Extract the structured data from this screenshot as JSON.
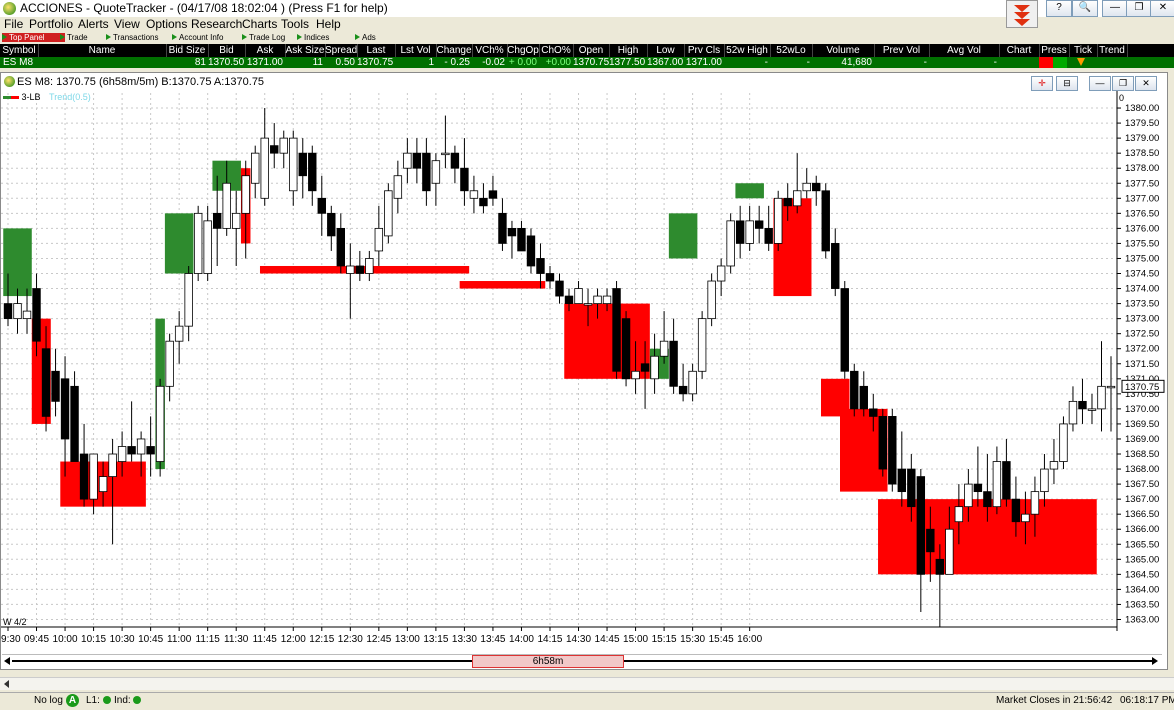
{
  "window": {
    "title": "ACCIONES - QuoteTracker - (04/17/08 18:02:04 ) (Press F1 for help)",
    "controls": [
      "?",
      "🔍",
      "—",
      "❐",
      "✕"
    ]
  },
  "menu": [
    "File",
    "Portfolio",
    "Alerts",
    "View",
    "Options",
    "Research",
    "Charts",
    "Tools",
    "Help"
  ],
  "tabs": [
    "Top Panel",
    "Trade",
    "Transactions",
    "Account Info",
    "Trade Log",
    "Indices",
    "Ads"
  ],
  "quote_table": {
    "columns": [
      "Symbol",
      "Name",
      "Bid Size",
      "Bid",
      "Ask",
      "Ask Size",
      "Spread",
      "Last",
      "Lst Vol",
      "Change",
      "VCh%",
      "ChgOp",
      "ChO%",
      "Open",
      "High",
      "Low",
      "Prv Cls",
      "52w High",
      "52wLo",
      "Volume",
      "Prev Vol",
      "Avg Vol",
      "Chart",
      "Press",
      "Tick",
      "Trend"
    ],
    "row": [
      "ES M8",
      "",
      "81",
      "1370.50",
      "1371.00",
      "11",
      "0.50",
      "1370.75",
      "1",
      "- 0.25",
      "-0.02",
      "+ 0.00",
      "+0.00",
      "1370.75",
      "1377.50",
      "1367.00",
      "1371.00",
      "-",
      "-",
      "41,680",
      "-",
      "-",
      "",
      "",
      "",
      ""
    ]
  },
  "chart_window": {
    "title": "ES M8: 1370.75 (6h58m/5m)  B:1370.75  A:1370.75",
    "legend_main": "3-LB",
    "legend_study": "Trend(0.5)",
    "day_marker": "W 4/2",
    "scroll_label": "6h58m",
    "current_price_label": "1370.75",
    "yaxis_top_marker": "0"
  },
  "chart_data": {
    "type": "candlestick",
    "symbol": "ES M8",
    "interval": "5m",
    "ylim": [
      1362.75,
      1380.5
    ],
    "y_ticks": [
      "1380.00",
      "1379.50",
      "1379.00",
      "1378.50",
      "1378.00",
      "1377.50",
      "1377.00",
      "1376.50",
      "1376.00",
      "1375.50",
      "1375.00",
      "1374.50",
      "1374.00",
      "1373.50",
      "1373.00",
      "1372.50",
      "1372.00",
      "1371.50",
      "1371.00",
      "1370.50",
      "1370.00",
      "1369.50",
      "1369.00",
      "1368.50",
      "1368.00",
      "1367.50",
      "1367.00",
      "1366.50",
      "1366.00",
      "1365.50",
      "1365.00",
      "1364.50",
      "1364.00",
      "1363.50",
      "1363.00"
    ],
    "x_ticks": [
      "09:30",
      "09:45",
      "10:00",
      "10:15",
      "10:30",
      "10:45",
      "11:00",
      "11:15",
      "11:30",
      "11:45",
      "12:00",
      "12:15",
      "12:30",
      "12:45",
      "13:00",
      "13:15",
      "13:30",
      "13:45",
      "14:00",
      "14:15",
      "14:30",
      "14:45",
      "15:00",
      "15:15",
      "15:30",
      "15:45",
      "16:00"
    ],
    "candles": [
      [
        1373.5,
        1374.5,
        1372.75,
        1373.0
      ],
      [
        1373.0,
        1374.0,
        1372.5,
        1373.5
      ],
      [
        1373.0,
        1374.0,
        1372.5,
        1373.25
      ],
      [
        1374.0,
        1374.5,
        1371.75,
        1372.25
      ],
      [
        1372.0,
        1372.75,
        1369.25,
        1369.75
      ],
      [
        1371.25,
        1372.0,
        1369.75,
        1370.25
      ],
      [
        1371.0,
        1371.75,
        1367.75,
        1369.0
      ],
      [
        1370.75,
        1371.25,
        1368.5,
        1368.25
      ],
      [
        1368.5,
        1369.5,
        1366.75,
        1367.0
      ],
      [
        1367.0,
        1368.5,
        1366.5,
        1368.5
      ],
      [
        1367.25,
        1368.25,
        1366.75,
        1367.75
      ],
      [
        1367.75,
        1369.0,
        1365.5,
        1368.5
      ],
      [
        1368.25,
        1369.25,
        1367.75,
        1368.75
      ],
      [
        1368.75,
        1370.25,
        1368.25,
        1368.5
      ],
      [
        1368.5,
        1369.25,
        1367.75,
        1369.0
      ],
      [
        1368.75,
        1369.75,
        1367.75,
        1368.5
      ],
      [
        1368.25,
        1371.0,
        1367.75,
        1370.75
      ],
      [
        1370.75,
        1372.5,
        1370.25,
        1372.25
      ],
      [
        1372.25,
        1373.25,
        1371.5,
        1372.75
      ],
      [
        1372.75,
        1374.75,
        1372.25,
        1374.5
      ],
      [
        1374.5,
        1376.75,
        1374.25,
        1376.5
      ],
      [
        1374.5,
        1376.75,
        1374.25,
        1376.25
      ],
      [
        1376.5,
        1377.75,
        1374.75,
        1376.0
      ],
      [
        1376.0,
        1378.25,
        1375.75,
        1377.5
      ],
      [
        1376.0,
        1377.25,
        1374.75,
        1376.5
      ],
      [
        1376.5,
        1378.25,
        1375.0,
        1377.75
      ],
      [
        1377.5,
        1378.75,
        1377.0,
        1378.5
      ],
      [
        1377.0,
        1380.0,
        1376.75,
        1379.0
      ],
      [
        1378.75,
        1379.5,
        1378.0,
        1378.5
      ],
      [
        1378.5,
        1379.25,
        1378.0,
        1379.0
      ],
      [
        1377.25,
        1379.25,
        1376.75,
        1379.0
      ],
      [
        1378.5,
        1379.0,
        1377.0,
        1377.75
      ],
      [
        1378.5,
        1378.75,
        1376.75,
        1377.25
      ],
      [
        1377.0,
        1377.75,
        1375.75,
        1376.5
      ],
      [
        1376.5,
        1376.75,
        1375.25,
        1375.75
      ],
      [
        1376.0,
        1376.5,
        1374.5,
        1374.75
      ],
      [
        1374.5,
        1375.5,
        1373.0,
        1374.75
      ],
      [
        1374.75,
        1375.25,
        1374.25,
        1374.5
      ],
      [
        1374.5,
        1375.25,
        1374.25,
        1375.0
      ],
      [
        1375.25,
        1376.75,
        1374.75,
        1376.0
      ],
      [
        1375.75,
        1377.5,
        1375.5,
        1377.25
      ],
      [
        1377.0,
        1378.25,
        1376.5,
        1377.75
      ],
      [
        1378.0,
        1379.0,
        1377.5,
        1378.5
      ],
      [
        1378.5,
        1379.0,
        1377.5,
        1378.0
      ],
      [
        1378.5,
        1379.0,
        1376.75,
        1377.25
      ],
      [
        1377.5,
        1378.5,
        1376.75,
        1378.25
      ],
      [
        1378.5,
        1379.75,
        1378.0,
        1378.5
      ],
      [
        1378.5,
        1378.75,
        1377.5,
        1378.0
      ],
      [
        1378.0,
        1379.0,
        1376.75,
        1377.25
      ],
      [
        1377.0,
        1377.75,
        1376.5,
        1377.25
      ],
      [
        1377.0,
        1377.5,
        1376.5,
        1376.75
      ],
      [
        1377.25,
        1377.75,
        1376.75,
        1377.0
      ],
      [
        1376.5,
        1377.0,
        1375.25,
        1375.5
      ],
      [
        1376.0,
        1376.25,
        1375.0,
        1375.75
      ],
      [
        1376.0,
        1376.25,
        1375.25,
        1375.25
      ],
      [
        1375.75,
        1376.0,
        1374.5,
        1374.75
      ],
      [
        1375.0,
        1375.5,
        1374.0,
        1374.5
      ],
      [
        1374.5,
        1374.75,
        1374.0,
        1374.25
      ],
      [
        1374.25,
        1374.5,
        1373.5,
        1373.75
      ],
      [
        1373.75,
        1374.0,
        1373.25,
        1373.5
      ],
      [
        1373.5,
        1374.25,
        1373.5,
        1374.0
      ],
      [
        1373.5,
        1374.0,
        1372.75,
        1373.5
      ],
      [
        1373.5,
        1374.0,
        1373.0,
        1373.75
      ],
      [
        1373.5,
        1374.0,
        1373.25,
        1373.75
      ],
      [
        1374.0,
        1374.25,
        1371.0,
        1371.25
      ],
      [
        1373.0,
        1373.25,
        1370.75,
        1371.0
      ],
      [
        1371.0,
        1372.25,
        1370.5,
        1371.25
      ],
      [
        1371.5,
        1372.25,
        1370.0,
        1371.25
      ],
      [
        1371.0,
        1372.5,
        1370.5,
        1371.75
      ],
      [
        1371.75,
        1373.25,
        1371.5,
        1372.25
      ],
      [
        1372.25,
        1373.0,
        1370.5,
        1370.75
      ],
      [
        1370.75,
        1371.5,
        1370.25,
        1370.5
      ],
      [
        1370.5,
        1371.5,
        1370.25,
        1371.25
      ],
      [
        1371.25,
        1373.25,
        1371.0,
        1373.0
      ],
      [
        1373.0,
        1374.5,
        1372.75,
        1374.25
      ],
      [
        1374.25,
        1375.0,
        1373.75,
        1374.75
      ],
      [
        1374.75,
        1376.5,
        1374.5,
        1376.25
      ],
      [
        1376.25,
        1376.75,
        1375.0,
        1375.5
      ],
      [
        1375.5,
        1376.75,
        1375.25,
        1376.25
      ],
      [
        1376.25,
        1376.75,
        1375.5,
        1376.0
      ],
      [
        1376.0,
        1376.75,
        1375.25,
        1375.5
      ],
      [
        1375.5,
        1377.25,
        1375.25,
        1377.0
      ],
      [
        1377.0,
        1377.5,
        1376.25,
        1376.75
      ],
      [
        1376.75,
        1378.5,
        1376.5,
        1377.25
      ],
      [
        1377.25,
        1378.0,
        1377.0,
        1377.5
      ],
      [
        1377.5,
        1377.75,
        1376.75,
        1377.25
      ],
      [
        1377.25,
        1377.5,
        1375.0,
        1375.25
      ],
      [
        1375.5,
        1376.0,
        1373.75,
        1374.0
      ],
      [
        1374.0,
        1374.25,
        1371.0,
        1371.25
      ],
      [
        1371.25,
        1371.5,
        1369.75,
        1370.0
      ],
      [
        1370.75,
        1371.25,
        1369.75,
        1370.0
      ],
      [
        1370.0,
        1370.5,
        1369.25,
        1369.75
      ],
      [
        1369.75,
        1370.0,
        1367.75,
        1368.0
      ],
      [
        1369.75,
        1370.0,
        1367.25,
        1367.5
      ],
      [
        1368.0,
        1369.25,
        1366.75,
        1367.25
      ],
      [
        1368.0,
        1368.5,
        1366.25,
        1366.75
      ],
      [
        1367.75,
        1368.0,
        1363.25,
        1364.5
      ],
      [
        1366.0,
        1366.75,
        1364.25,
        1365.25
      ],
      [
        1365.0,
        1365.5,
        1362.75,
        1364.5
      ],
      [
        1364.5,
        1366.75,
        1364.5,
        1366.0
      ],
      [
        1366.25,
        1367.5,
        1365.5,
        1366.75
      ],
      [
        1366.75,
        1368.0,
        1366.25,
        1367.5
      ],
      [
        1367.5,
        1368.75,
        1366.75,
        1367.25
      ],
      [
        1367.25,
        1368.5,
        1366.25,
        1366.75
      ],
      [
        1366.75,
        1368.75,
        1366.5,
        1368.25
      ],
      [
        1368.25,
        1369.0,
        1366.75,
        1367.0
      ],
      [
        1367.0,
        1367.75,
        1365.75,
        1366.25
      ],
      [
        1366.25,
        1367.25,
        1365.5,
        1366.5
      ],
      [
        1366.5,
        1367.75,
        1365.75,
        1367.25
      ],
      [
        1367.25,
        1368.5,
        1366.75,
        1368.0
      ],
      [
        1368.0,
        1369.0,
        1367.5,
        1368.25
      ],
      [
        1368.25,
        1369.75,
        1368.0,
        1369.5
      ],
      [
        1369.5,
        1370.75,
        1369.25,
        1370.25
      ],
      [
        1370.25,
        1371.0,
        1369.5,
        1370.0
      ],
      [
        1370.0,
        1370.5,
        1369.5,
        1370.0
      ],
      [
        1370.0,
        1372.25,
        1369.25,
        1370.75
      ],
      [
        1370.75,
        1371.75,
        1369.25,
        1370.75
      ]
    ],
    "trend_boxes": [
      {
        "color": "green",
        "from": 0,
        "to": 2,
        "low": 1373.75,
        "high": 1376.0
      },
      {
        "color": "red",
        "from": 3,
        "to": 4,
        "low": 1369.5,
        "high": 1373.0
      },
      {
        "color": "red",
        "from": 6,
        "to": 14,
        "low": 1366.75,
        "high": 1368.25
      },
      {
        "color": "green",
        "from": 16,
        "to": 16,
        "low": 1368.0,
        "high": 1373.0
      },
      {
        "color": "green",
        "from": 17,
        "to": 19,
        "low": 1374.5,
        "high": 1376.5
      },
      {
        "color": "green",
        "from": 22,
        "to": 24,
        "low": 1377.25,
        "high": 1378.25
      },
      {
        "color": "red",
        "from": 25,
        "to": 25,
        "low": 1375.5,
        "high": 1378.0
      },
      {
        "color": "red",
        "from": 27,
        "to": 48,
        "low": 1374.5,
        "high": 1374.75
      },
      {
        "color": "red",
        "from": 48,
        "to": 56,
        "low": 1374.0,
        "high": 1374.25
      },
      {
        "color": "red",
        "from": 59,
        "to": 67,
        "low": 1371.0,
        "high": 1373.5
      },
      {
        "color": "green",
        "from": 68,
        "to": 69,
        "low": 1371.0,
        "high": 1372.0
      },
      {
        "color": "green",
        "from": 70,
        "to": 72,
        "low": 1375.0,
        "high": 1376.5
      },
      {
        "color": "green",
        "from": 77,
        "to": 79,
        "low": 1377.0,
        "high": 1377.5
      },
      {
        "color": "red",
        "from": 81,
        "to": 84,
        "low": 1373.75,
        "high": 1377.0
      },
      {
        "color": "red",
        "from": 86,
        "to": 88,
        "low": 1369.75,
        "high": 1371.0
      },
      {
        "color": "red",
        "from": 88,
        "to": 92,
        "low": 1367.25,
        "high": 1370.0
      },
      {
        "color": "red",
        "from": 92,
        "to": 114,
        "low": 1364.5,
        "high": 1367.0
      }
    ],
    "colors": {
      "up_box": "#2e8b2e",
      "down_box": "#ff0000",
      "up_candle": "#ffffff",
      "down_candle": "#000000"
    }
  },
  "status": {
    "log": "No log",
    "l1": "L1:",
    "ind": "Ind:",
    "market": "Market Closes in 21:56:42",
    "clock": "06:18:17 PM"
  }
}
